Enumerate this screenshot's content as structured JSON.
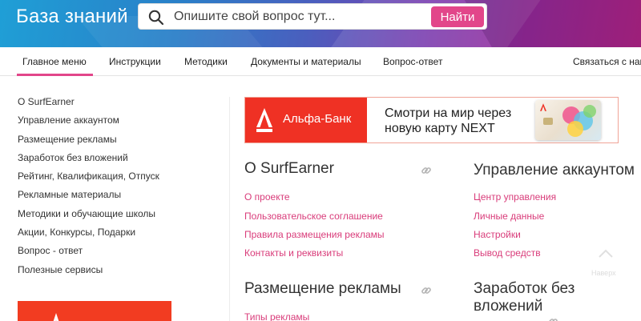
{
  "header": {
    "title": "База знаний",
    "search": {
      "placeholder": "Опишите свой вопрос тут...",
      "value": "",
      "button_label": "Найти"
    }
  },
  "nav": {
    "items": [
      {
        "label": "Главное меню",
        "active": true
      },
      {
        "label": "Инструкции"
      },
      {
        "label": "Методики"
      },
      {
        "label": "Документы и материалы"
      },
      {
        "label": "Вопрос-ответ"
      },
      {
        "label": "Связаться с нам"
      }
    ]
  },
  "sidebar": {
    "items": [
      {
        "label": "О SurfEarner"
      },
      {
        "label": "Управление аккаунтом"
      },
      {
        "label": "Размещение рекламы"
      },
      {
        "label": "Заработок без вложений"
      },
      {
        "label": "Рейтинг, Квалификация, Отпуск"
      },
      {
        "label": "Рекламные материалы"
      },
      {
        "label": "Методики и обучающие школы"
      },
      {
        "label": "Акции, Конкурсы, Подарки"
      },
      {
        "label": "Вопрос - ответ"
      },
      {
        "label": "Полезные сервисы"
      }
    ]
  },
  "ad": {
    "brand": "Альфа-Банк",
    "text": "Смотри на мир через новую карту NEXT",
    "colors": {
      "brand_red": "#ef3124"
    }
  },
  "sections": [
    {
      "title": "О SurfEarner",
      "links": [
        "О проекте",
        "Пользовательское соглашение",
        "Правила размещения рекламы",
        "Контакты и реквизиты"
      ]
    },
    {
      "title": "Управление аккаунтом",
      "links": [
        "Центр управления",
        "Личные данные",
        "Настройки",
        "Вывод средств"
      ]
    },
    {
      "title": "Размещение рекламы",
      "links": [
        "Типы рекламы"
      ]
    },
    {
      "title": "Заработок без вложений",
      "links": []
    }
  ],
  "scroll_top": {
    "label": "Наверх"
  },
  "colors": {
    "accent": "#e2468a",
    "link": "#d93c7a"
  }
}
